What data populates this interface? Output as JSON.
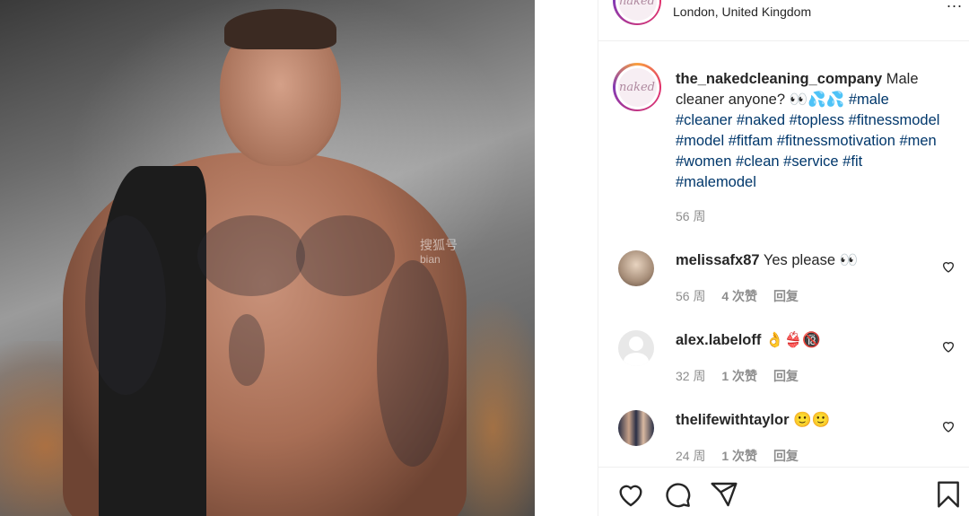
{
  "post": {
    "location": "London, United Kingdom",
    "more_label": "...",
    "avatar_logo": "naked",
    "caption": {
      "username": "the_nakedcleaning_company",
      "text": "Male cleaner anyone? 👀💦💦",
      "hashtags": "#male #cleaner #naked #topless #fitnessmodel #model #fitfam #fitnessmotivation #men #women #clean #service #fit #malemodel"
    },
    "time": "56 周"
  },
  "photo": {
    "watermark": "搜狐号",
    "watermark_sub": "bian"
  },
  "comments": [
    {
      "username": "melissafx87",
      "text": "Yes please 👀",
      "time": "56 周",
      "likes": "4 次赞",
      "reply": "回复"
    },
    {
      "username": "alex.labeloff",
      "text": "👌👙🔞",
      "time": "32 周",
      "likes": "1 次赞",
      "reply": "回复"
    },
    {
      "username": "thelifewithtaylor",
      "text": "🙂🙂",
      "time": "24 周",
      "likes": "1 次赞",
      "reply": "回复"
    }
  ],
  "icons": {
    "like": "heart-icon",
    "comment": "comment-icon",
    "share": "share-icon",
    "save": "bookmark-icon"
  }
}
